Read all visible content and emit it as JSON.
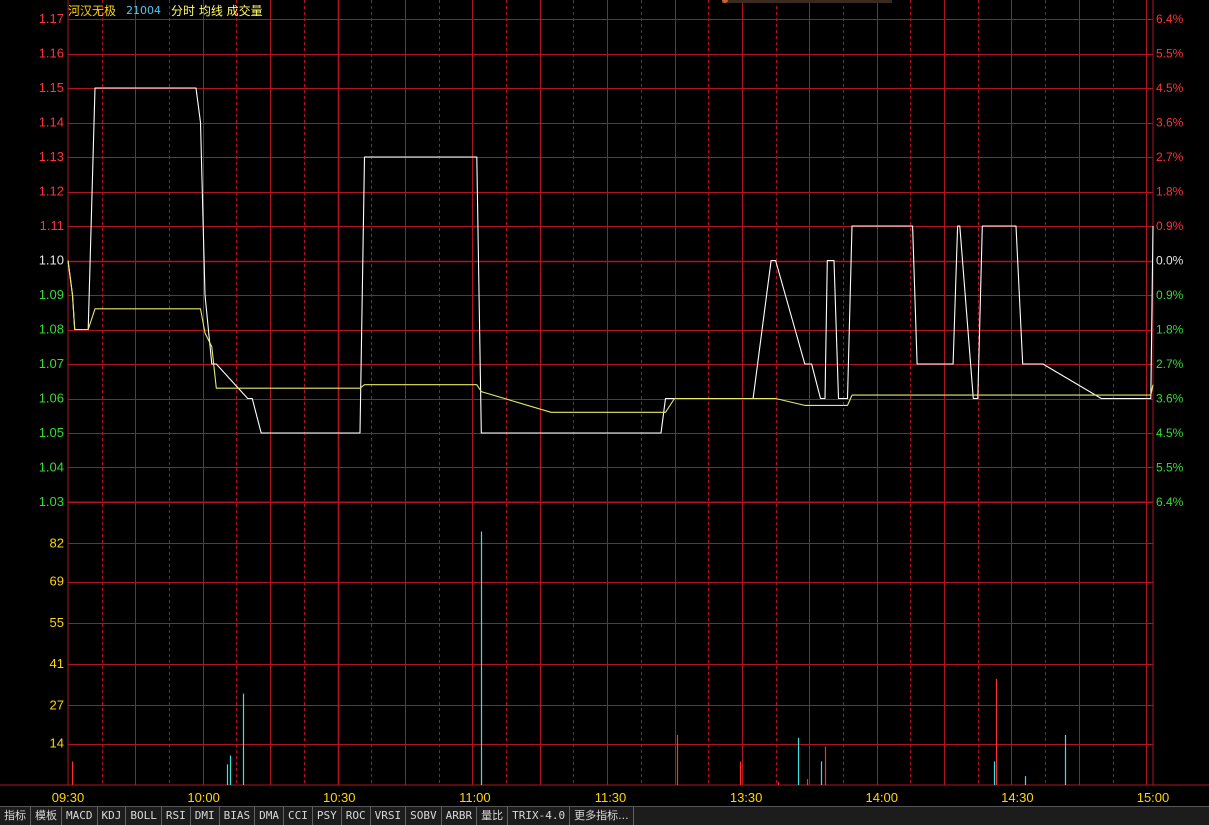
{
  "header": {
    "stock_name": "河汉无极",
    "stock_code": "21004",
    "view_tags": "分时 均线 成交量"
  },
  "colors": {
    "background": "#000000",
    "grid": "#b0141e",
    "price_line": "#ffffff",
    "avg_line": "#e8e86a",
    "up": "#ff3333",
    "down": "#33dd33",
    "flat": "#e6e6e6",
    "vol_label": "#ffd700",
    "vol_up": "#ff3030",
    "vol_down": "#40e0e0"
  },
  "tabs": [
    "指标",
    "模板",
    "MACD",
    "KDJ",
    "BOLL",
    "RSI",
    "DMI",
    "BIAS",
    "DMA",
    "CCI",
    "PSY",
    "ROC",
    "VRSI",
    "SOBV",
    "ARBR",
    "量比",
    "TRIX-4.0",
    "更多指标..."
  ],
  "chart_data": {
    "type": "line",
    "prev_close": 1.1,
    "x_ticks": [
      "09:30",
      "10:00",
      "10:30",
      "11:00",
      "11:30",
      "13:30",
      "14:00",
      "14:30",
      "15:00"
    ],
    "price_ticks": [
      "1.17",
      "1.16",
      "1.15",
      "1.14",
      "1.13",
      "1.12",
      "1.11",
      "1.10",
      "1.09",
      "1.08",
      "1.07",
      "1.06",
      "1.05",
      "1.04",
      "1.03"
    ],
    "pct_ticks": [
      "6.4%",
      "5.5%",
      "4.5%",
      "3.6%",
      "2.7%",
      "1.8%",
      "0.9%",
      "0.0%",
      "0.9%",
      "1.8%",
      "2.7%",
      "3.6%",
      "4.5%",
      "5.5%",
      "6.4%"
    ],
    "ylim": [
      1.03,
      1.17
    ],
    "volume_ticks": [
      "82",
      "69",
      "55",
      "41",
      "27",
      "14"
    ],
    "volume_ylim": [
      0,
      96
    ],
    "series": [
      {
        "x": [
          0,
          2,
          3,
          7,
          9,
          12,
          57,
          59,
          61,
          64,
          66,
          80,
          82,
          86,
          130,
          132,
          134,
          182,
          184,
          215,
          217,
          218,
          264,
          266,
          270,
          305,
          307,
          313,
          315,
          328,
          331,
          335,
          337,
          338,
          341,
          343,
          347,
          349,
          350,
          360,
          362,
          363,
          376,
          378,
          394,
          396,
          397,
          403,
          405,
          407,
          410,
          422,
          425,
          432,
          434,
          460,
          462,
          467,
          470,
          480,
          482,
          483
        ],
        "values": [
          1.1,
          1.09,
          1.08,
          1.08,
          1.08,
          1.15,
          1.15,
          1.14,
          1.09,
          1.07,
          1.07,
          1.06,
          1.06,
          1.05,
          1.05,
          1.13,
          1.13,
          1.13,
          1.05,
          1.05,
          1.05,
          1.05,
          1.05,
          1.06,
          1.06,
          1.06,
          1.07,
          1.1,
          1.1,
          1.07,
          1.07,
          1.06,
          1.06,
          1.1,
          1.1,
          1.06,
          1.06,
          1.11,
          1.11,
          1.11,
          1.11,
          1.11,
          1.11,
          1.07,
          1.07,
          1.11,
          1.11,
          1.06,
          1.06,
          1.11,
          1.11,
          1.11,
          1.07,
          1.07,
          1.07,
          1.06,
          1.06,
          1.06,
          1.06,
          1.06,
          1.06,
          1.11
        ]
      },
      {
        "x": [
          0,
          2,
          3,
          7,
          9,
          12,
          57,
          59,
          61,
          64,
          66,
          80,
          82,
          86,
          130,
          132,
          134,
          182,
          184,
          215,
          217,
          218,
          264,
          266,
          270,
          305,
          307,
          313,
          315,
          328,
          331,
          335,
          337,
          338,
          341,
          343,
          347,
          349,
          350,
          360,
          362,
          363,
          376,
          378,
          394,
          396,
          397,
          403,
          405,
          407,
          410,
          422,
          425,
          432,
          434,
          460,
          462,
          467,
          470,
          480,
          482,
          483
        ],
        "values": [
          1.1,
          1.09,
          1.08,
          1.08,
          1.08,
          1.086,
          1.086,
          1.086,
          1.079,
          1.075,
          1.063,
          1.063,
          1.063,
          1.063,
          1.063,
          1.064,
          1.064,
          1.064,
          1.062,
          1.056,
          1.056,
          1.056,
          1.056,
          1.056,
          1.06,
          1.06,
          1.06,
          1.06,
          1.06,
          1.058,
          1.058,
          1.058,
          1.058,
          1.058,
          1.058,
          1.058,
          1.058,
          1.061,
          1.061,
          1.061,
          1.061,
          1.061,
          1.061,
          1.061,
          1.061,
          1.061,
          1.061,
          1.061,
          1.061,
          1.061,
          1.061,
          1.061,
          1.061,
          1.061,
          1.061,
          1.061,
          1.061,
          1.061,
          1.061,
          1.061,
          1.061,
          1.064
        ]
      }
    ],
    "volume": [
      {
        "x": 2,
        "v": 8,
        "dir": "up"
      },
      {
        "x": 71,
        "v": 7,
        "dir": "down"
      },
      {
        "x": 72,
        "v": 10,
        "dir": "down"
      },
      {
        "x": 78,
        "v": 31,
        "dir": "down"
      },
      {
        "x": 184,
        "v": 86,
        "dir": "down"
      },
      {
        "x": 271,
        "v": 17,
        "dir": "up"
      },
      {
        "x": 299,
        "v": 8,
        "dir": "up"
      },
      {
        "x": 316,
        "v": 1,
        "dir": "up"
      },
      {
        "x": 325,
        "v": 16,
        "dir": "down"
      },
      {
        "x": 329,
        "v": 2,
        "dir": "up"
      },
      {
        "x": 335,
        "v": 8,
        "dir": "down"
      },
      {
        "x": 337,
        "v": 13,
        "dir": "up"
      },
      {
        "x": 412,
        "v": 8,
        "dir": "down"
      },
      {
        "x": 413,
        "v": 36,
        "dir": "up"
      },
      {
        "x": 426,
        "v": 3,
        "dir": "down"
      },
      {
        "x": 444,
        "v": 17,
        "dir": "down"
      }
    ]
  }
}
